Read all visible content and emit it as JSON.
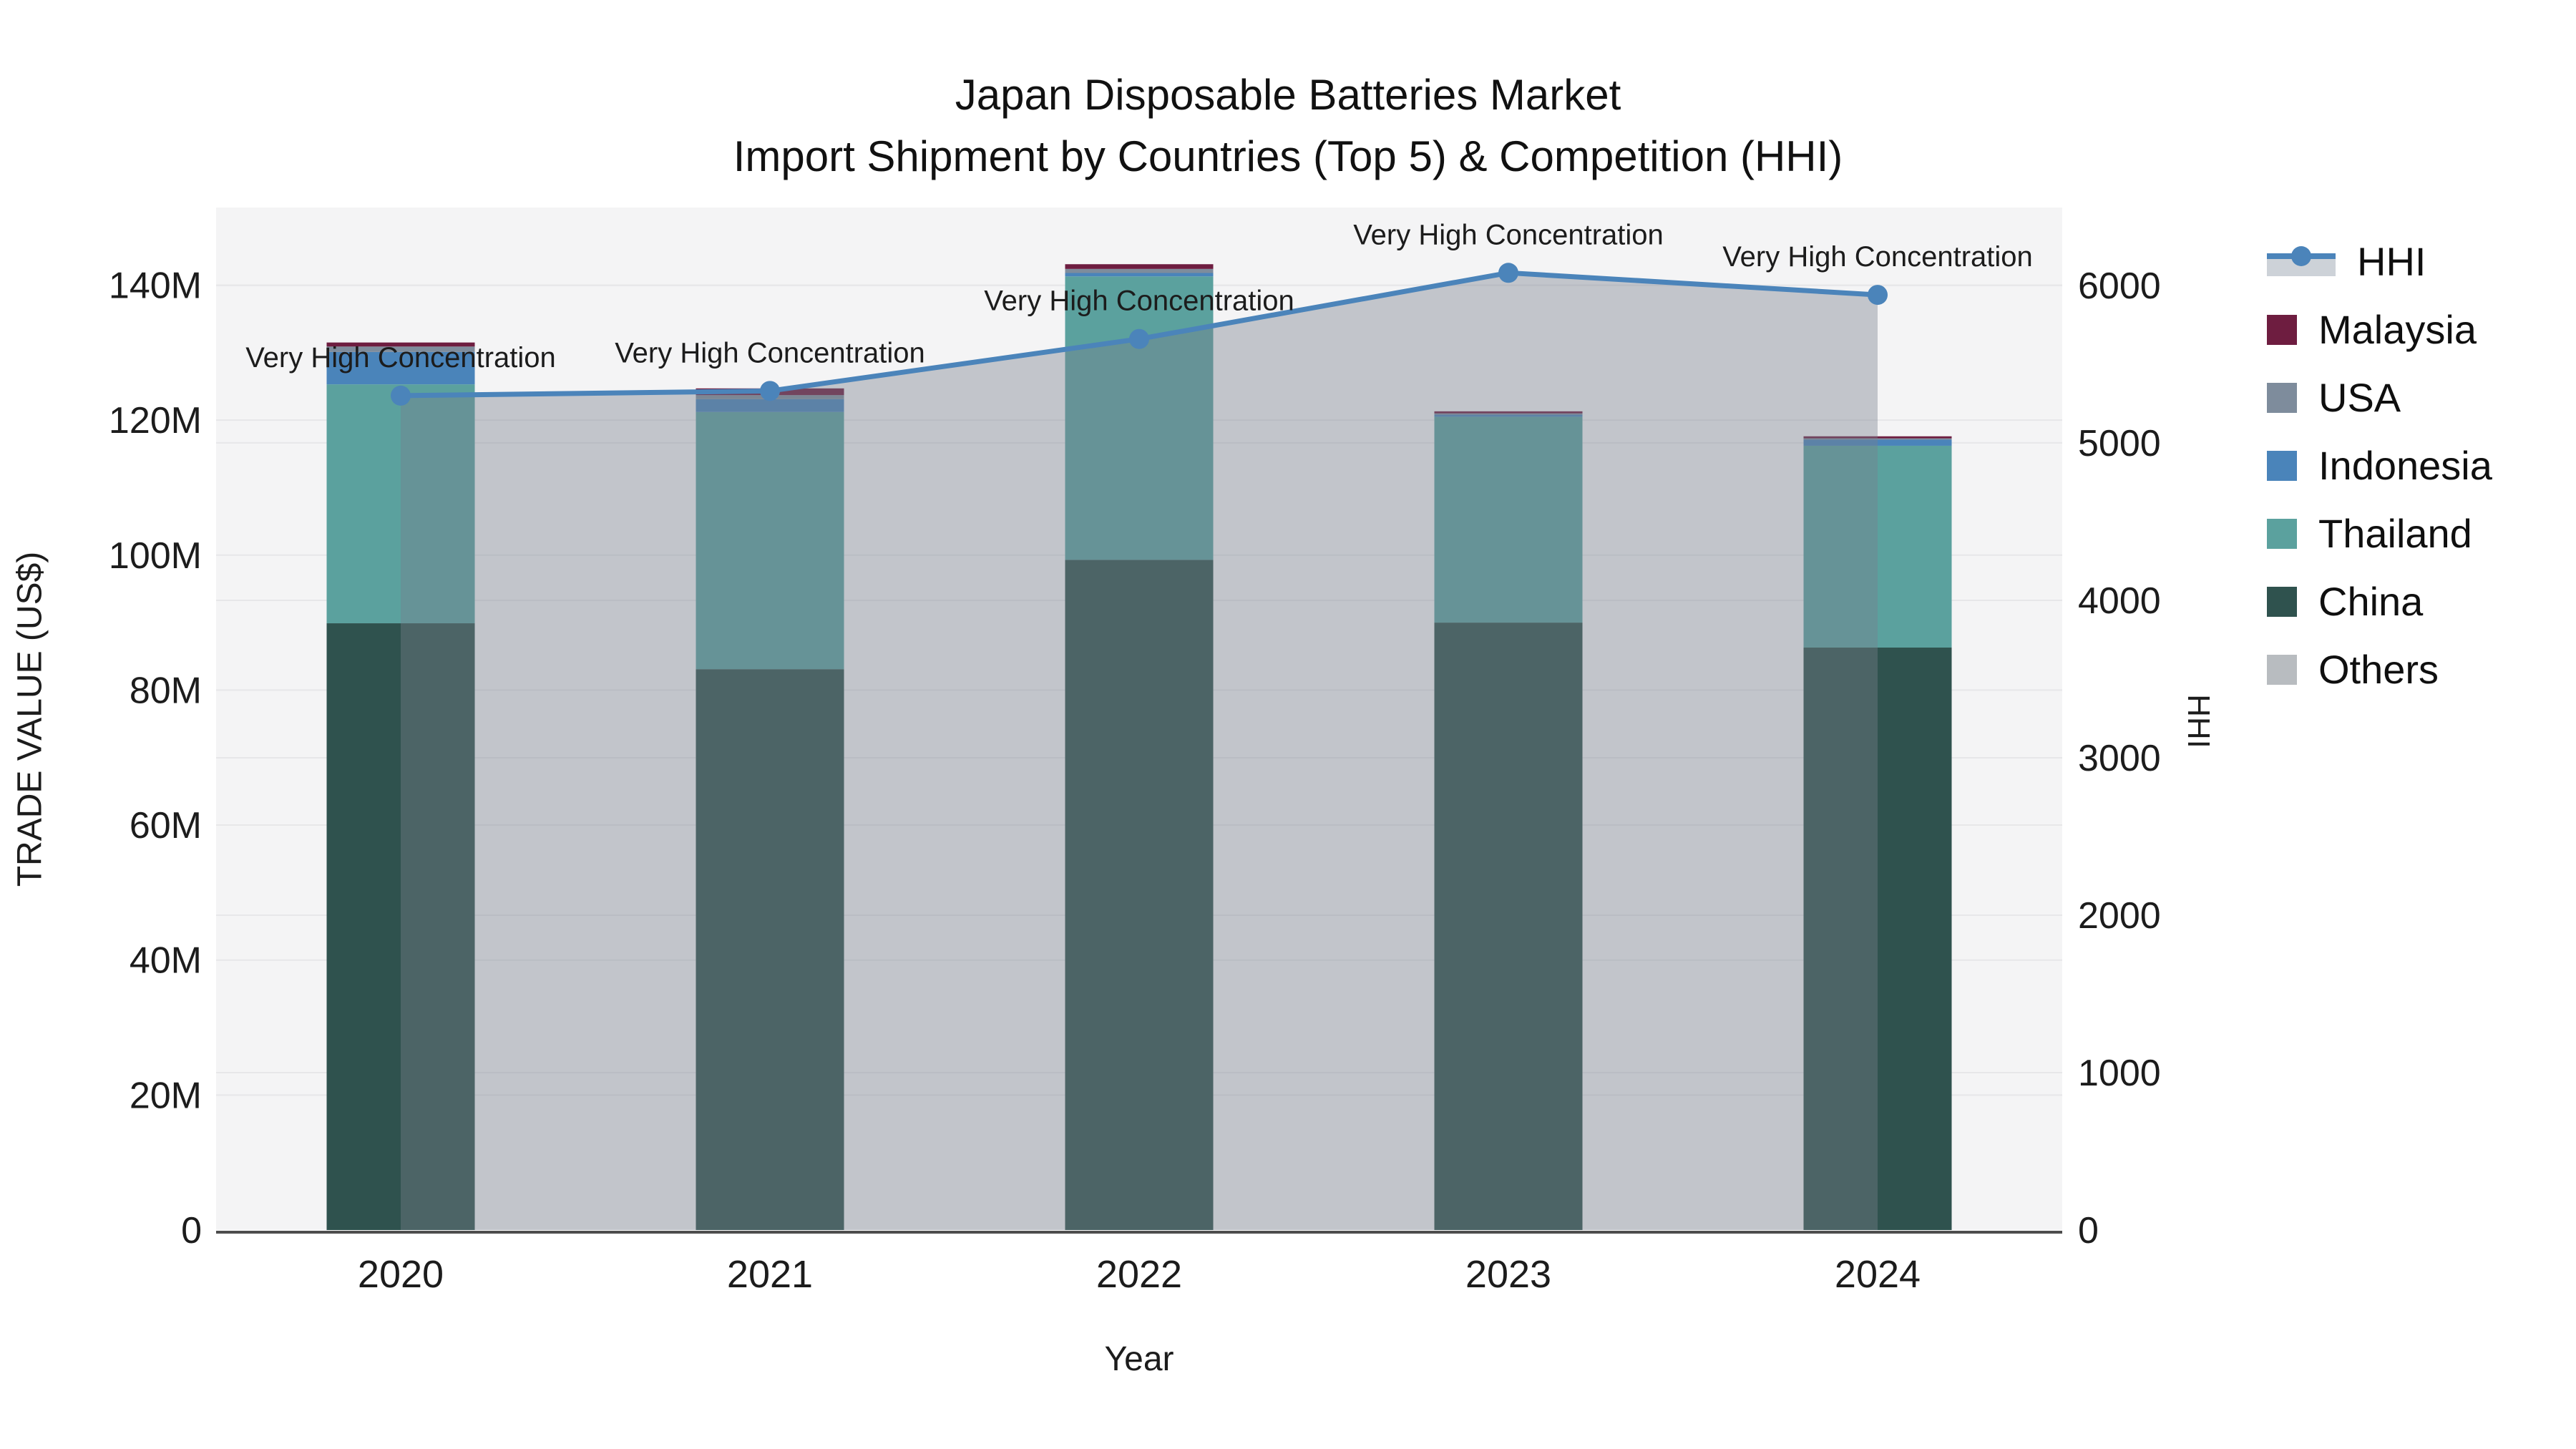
{
  "header": {
    "line1": "Japan Disposable Batteries Market",
    "line2": "Import Shipment by Countries (Top 5) & Competition (HHI)"
  },
  "legend": {
    "items": [
      {
        "label": "HHI",
        "type": "line",
        "color": "#4b84ba"
      },
      {
        "label": "Malaysia",
        "type": "swatch",
        "color": "#6e1d40"
      },
      {
        "label": "USA",
        "type": "swatch",
        "color": "#7e8c9c"
      },
      {
        "label": "Indonesia",
        "type": "swatch",
        "color": "#4a84ba"
      },
      {
        "label": "Thailand",
        "type": "swatch",
        "color": "#5ba19e"
      },
      {
        "label": "China",
        "type": "swatch",
        "color": "#2f524e"
      },
      {
        "label": "Others",
        "type": "swatch",
        "color": "#b8bcc0"
      }
    ]
  },
  "chart_data": {
    "type": "composite",
    "subtype": "stacked-bar + line-with-area",
    "categories": [
      "2020",
      "2021",
      "2022",
      "2023",
      "2024"
    ],
    "xlabel": "Year",
    "ylabel_left": "TRADE VALUE (US$)",
    "ylabel_right": "HHI",
    "bar_unit": "US$ millions",
    "bar_series": [
      {
        "name": "China",
        "color": "#2f524e",
        "values": [
          89.9,
          83.1,
          99.3,
          90.0,
          86.3
        ]
      },
      {
        "name": "Thailand",
        "color": "#5ba19e",
        "values": [
          35.4,
          38.1,
          42.0,
          30.5,
          29.9
        ]
      },
      {
        "name": "Indonesia",
        "color": "#4a84ba",
        "values": [
          4.8,
          1.9,
          0.5,
          0.3,
          0.9
        ]
      },
      {
        "name": "USA",
        "color": "#7e8c9c",
        "values": [
          0.8,
          0.6,
          0.6,
          0.2,
          0.2
        ]
      },
      {
        "name": "Malaysia",
        "color": "#6e1d40",
        "values": [
          0.6,
          1.0,
          0.7,
          0.3,
          0.3
        ]
      }
    ],
    "bar_totals": [
      131.5,
      124.7,
      143.1,
      121.3,
      117.6
    ],
    "line_series": {
      "name": "HHI",
      "axis": "right",
      "color": "#4b84ba",
      "area_fill": "rgba(120,128,140,0.40)",
      "values": [
        5300,
        5330,
        5660,
        6080,
        5940
      ]
    },
    "annotation_label": "Very High Concentration",
    "annotated_points": [
      0,
      1,
      2,
      3,
      4
    ],
    "ylim_left": [
      0,
      151.5
    ],
    "ylim_right": [
      0,
      6495
    ],
    "ytick_values_left": [
      0,
      20,
      40,
      60,
      80,
      100,
      120,
      140
    ],
    "ytick_labels_left": [
      "0",
      "20M",
      "40M",
      "60M",
      "80M",
      "100M",
      "120M",
      "140M"
    ],
    "ytick_values_right": [
      0,
      1000,
      2000,
      3000,
      4000,
      5000,
      6000
    ],
    "ytick_labels_right": [
      "0",
      "1000",
      "2000",
      "3000",
      "4000",
      "5000",
      "6000"
    ],
    "grid": true,
    "legend_position": "right",
    "colors": {
      "plot_bg": "#f4f4f5",
      "gridline": "#e7e7e9",
      "axis_line": "#4d4d4d",
      "annotation_text": "#111111"
    }
  }
}
